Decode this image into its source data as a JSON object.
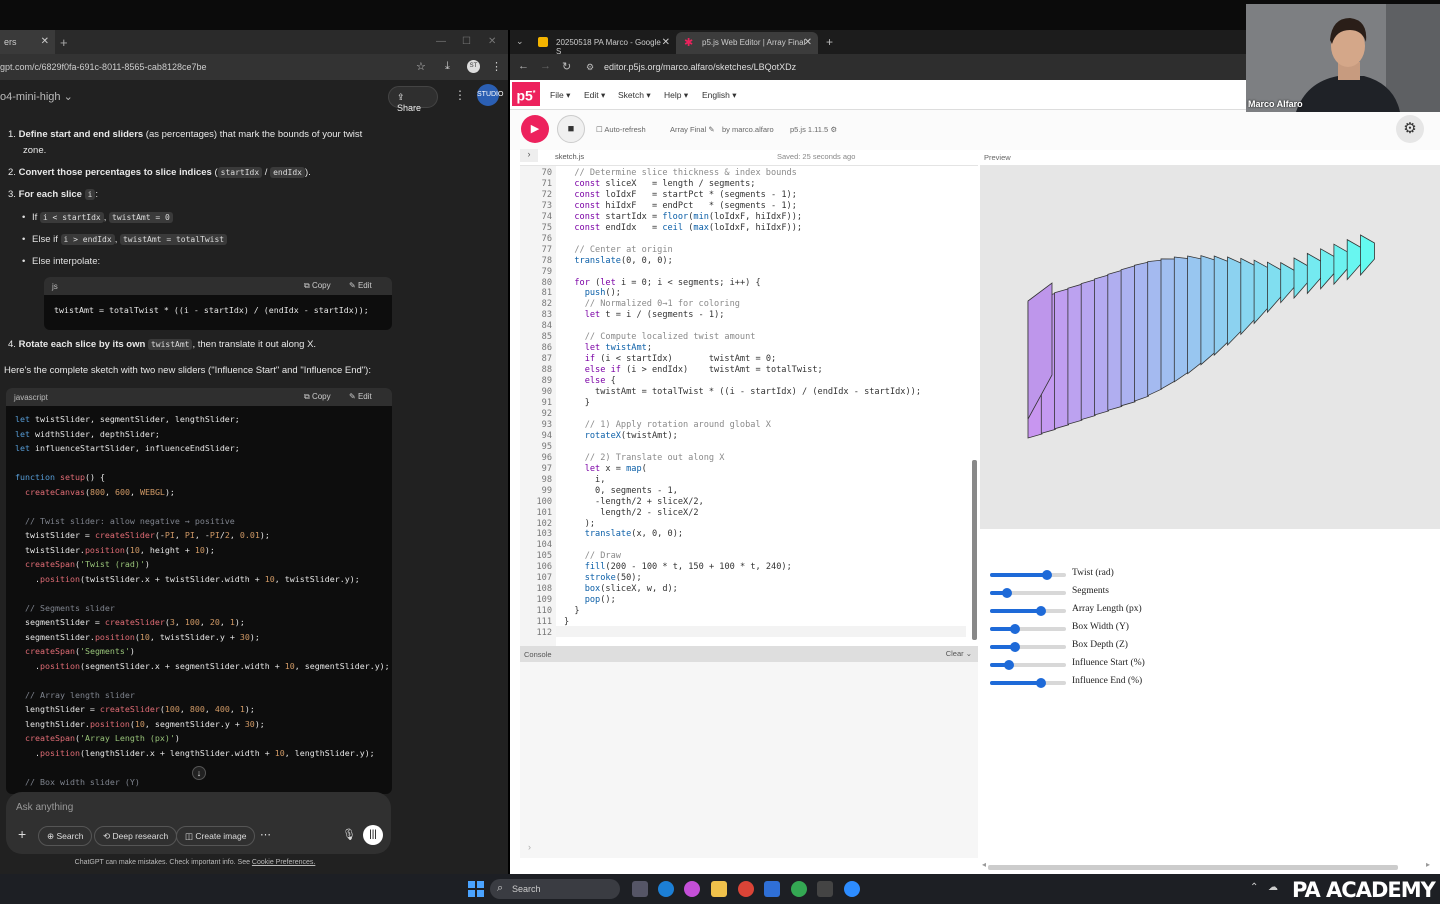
{
  "left_window": {
    "tab_title": "ers",
    "url": "gpt.com/c/6829f0fa-691c-8011-8565-cab8128ce7be",
    "model": "o4-mini-high",
    "share_label": "Share",
    "avatar_label": "STUDIO",
    "steps": [
      {
        "num": "1.",
        "bold": "Define start and end sliders",
        "rest": " (as percentages) that mark the bounds of your twist",
        "line2": "zone."
      },
      {
        "num": "2.",
        "bold": "Convert those percentages to slice indices",
        "rest": " (",
        "c1": "startIdx",
        "sep": " / ",
        "c2": "endIdx",
        "end": ")."
      },
      {
        "num": "3.",
        "bold": "For each slice",
        "c1": "i",
        "end": ":"
      },
      {
        "num": "4.",
        "bold": "Rotate each slice by its own",
        "c1": "twistAmt",
        "rest": ", then translate it out along X."
      }
    ],
    "bullets": [
      {
        "pre": "If ",
        "c1": "i < startIdx",
        "mid": ", ",
        "c2": "twistAmt = 0"
      },
      {
        "pre": "Else if ",
        "c1": "i > endIdx",
        "mid": ", ",
        "c2": "twistAmt = totalTwist"
      },
      {
        "pre": "Else interpolate:"
      }
    ],
    "snippet": {
      "lang": "js",
      "copy": "Copy",
      "edit": "Edit",
      "code": "twistAmt = totalTwist * ((i - startIdx) / (endIdx - startIdx));"
    },
    "intro": "Here's the complete sketch with two new sliders (\"Influence Start\" and \"Influence End\"):",
    "main_code": {
      "lang": "javascript",
      "copy": "Copy",
      "edit": "Edit"
    },
    "input_placeholder": "Ask anything",
    "pills": [
      "Search",
      "Deep research",
      "Create image"
    ],
    "footer": "ChatGPT can make mistakes. Check important info. See ",
    "footer_link": "Cookie Preferences."
  },
  "right_window": {
    "tabs": [
      {
        "label": "20250518 PA Marco - Google S"
      },
      {
        "label": "p5.js Web Editor | Array Final"
      }
    ],
    "url": "editor.p5js.org/marco.alfaro/sketches/LBQotXDz",
    "menu": [
      "File",
      "Edit",
      "Sketch",
      "Help",
      "English"
    ],
    "auto_refresh": "Auto-refresh",
    "sketch_name": "Array Final",
    "by": "by",
    "author": "marco.alfaro",
    "version": "p5.js 1.11.5",
    "file": "sketch.js",
    "saved": "Saved: 25 seconds ago",
    "preview_label": "Preview",
    "console_label": "Console",
    "clear_label": "Clear",
    "line_start": 70,
    "line_end": 112,
    "sliders": [
      {
        "label": "Twist (rad)",
        "value": 0.75
      },
      {
        "label": "Segments",
        "value": 0.22
      },
      {
        "label": "Array Length (px)",
        "value": 0.67
      },
      {
        "label": "Box Width (Y)",
        "value": 0.33
      },
      {
        "label": "Box Depth (Z)",
        "value": 0.33
      },
      {
        "label": "Influence Start (%)",
        "value": 0.25
      },
      {
        "label": "Influence End (%)",
        "value": 0.67
      }
    ]
  },
  "camera": {
    "name": "Marco Alfaro"
  },
  "taskbar": {
    "search": "Search",
    "brand": "PA ACADEMY"
  }
}
